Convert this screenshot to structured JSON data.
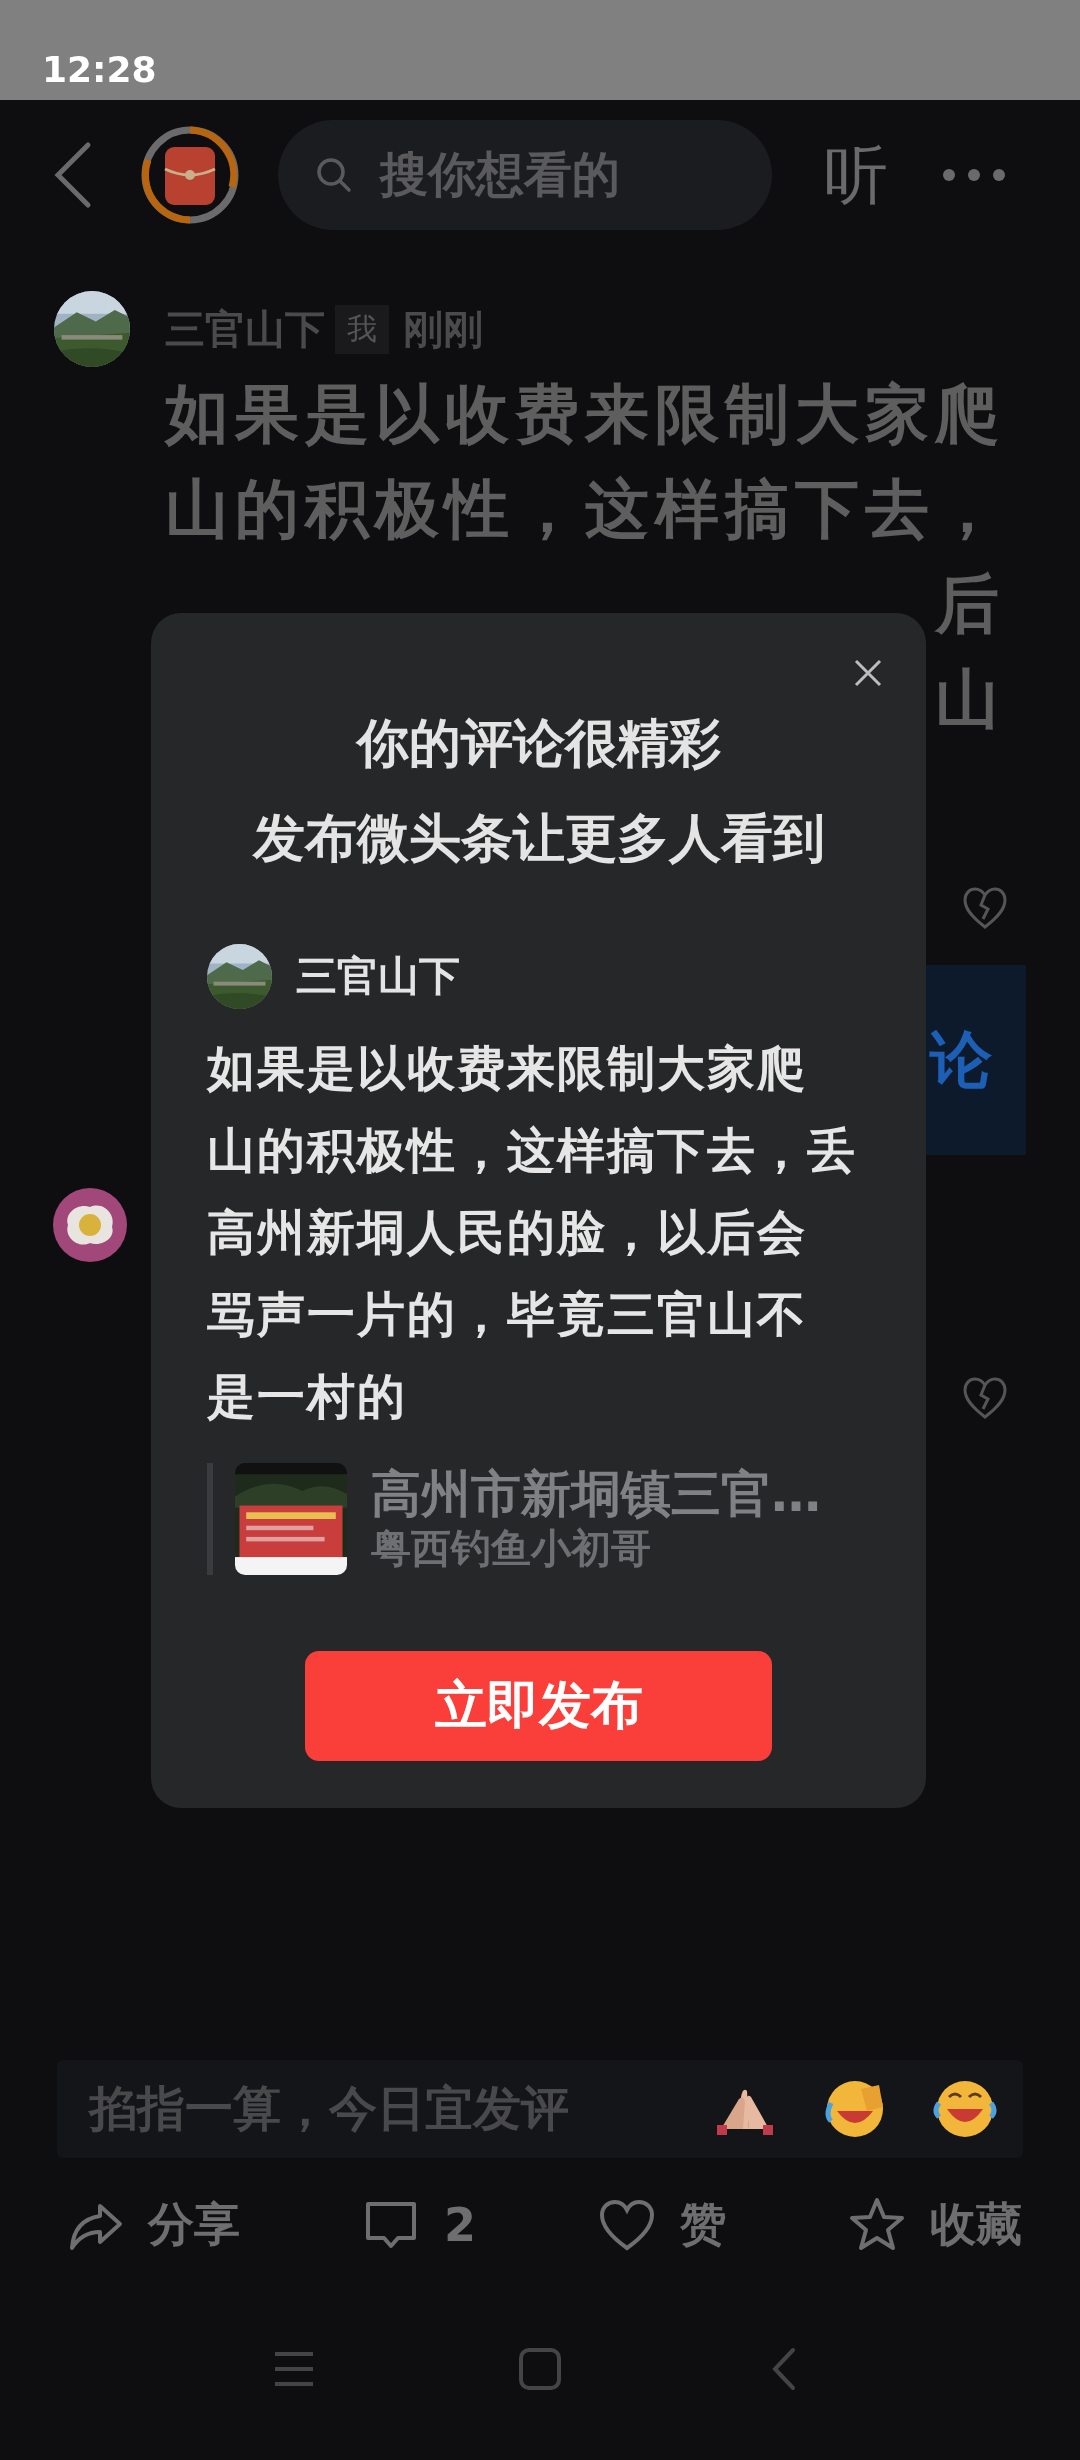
{
  "status_bar": {
    "time": "12:28"
  },
  "header": {
    "search": {
      "placeholder": "搜你想看的"
    },
    "listen": "听"
  },
  "comment": {
    "author": "三官山下",
    "tag": "我",
    "time": "刚刚",
    "lines": [
      "如果是以收费来限制大家爬",
      "山的积极性，这样搞下去，"
    ],
    "line_ends": [
      "后",
      "山"
    ]
  },
  "discuss_button": "论",
  "modal": {
    "title_lines": [
      "你的评论很精彩",
      "发布微头条让更多人看到"
    ],
    "author": "三官山下",
    "text_lines": [
      "如果是以收费来限制大家爬",
      "山的积极性，这样搞下去，丢",
      "高州新垌人民的脸，以后会",
      "骂声一片的，毕竟三官山不",
      "是一村的"
    ],
    "quote": {
      "title": "高州市新垌镇三官…",
      "author": "粤西钓鱼小初哥"
    },
    "button": "立即发布"
  },
  "comment_box": {
    "placeholder": "掐指一算，今日宜发评"
  },
  "actions": [
    {
      "kind": "share",
      "label": "分享"
    },
    {
      "kind": "comment",
      "label": "2"
    },
    {
      "kind": "like",
      "label": "赞"
    },
    {
      "kind": "favorite",
      "label": "收藏"
    }
  ]
}
